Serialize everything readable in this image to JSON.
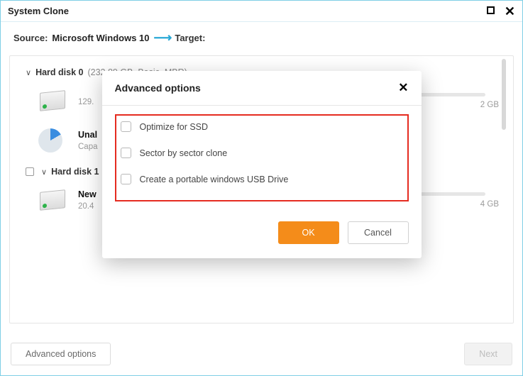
{
  "window": {
    "title": "System Clone"
  },
  "path": {
    "source_label": "Source:",
    "source_value": "Microsoft Windows 10",
    "target_label": "Target:",
    "target_value": ""
  },
  "disks": [
    {
      "header_name": "Hard disk 0",
      "header_caption": "(232.89 GB, Basic, MBR)",
      "show_select": false,
      "volumes": [
        {
          "icon": "hdd",
          "name": "",
          "sub": "129.",
          "size": "2 GB",
          "fill": 12
        },
        {
          "icon": "pie",
          "name": "Unal",
          "sub": "Capa",
          "size": "",
          "fill": 0,
          "nobar": true
        }
      ]
    },
    {
      "header_name": "Hard disk 1",
      "header_caption": "(",
      "show_select": true,
      "volumes": [
        {
          "icon": "hdd",
          "name": "New",
          "sub": "20.4",
          "size": "4 GB",
          "fill": 0
        }
      ]
    }
  ],
  "footer": {
    "advanced_label": "Advanced options",
    "next_label": "Next"
  },
  "modal": {
    "title": "Advanced options",
    "options": [
      "Optimize for SSD",
      "Sector by sector clone",
      "Create a portable windows USB Drive"
    ],
    "ok_label": "OK",
    "cancel_label": "Cancel"
  }
}
